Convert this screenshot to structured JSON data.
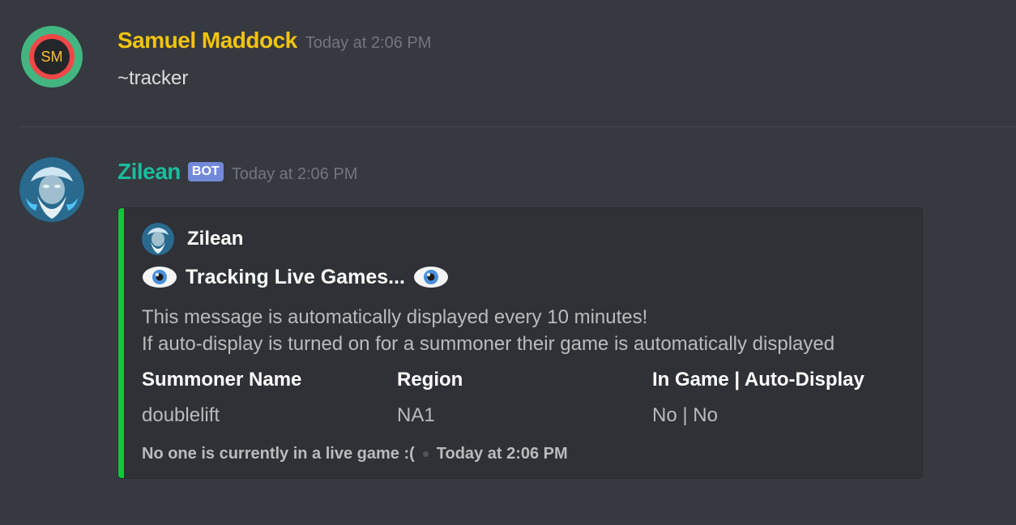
{
  "messages": [
    {
      "author": "Samuel Maddock",
      "avatar_initials": "SM",
      "timestamp": "Today at 2:06 PM",
      "content": "~tracker",
      "name_color": "#f1c40f"
    },
    {
      "author": "Zilean",
      "bot_tag": "BOT",
      "timestamp": "Today at 2:06 PM",
      "name_color": "#1abc9c",
      "embed": {
        "color": "#0ec73a",
        "author_name": "Zilean",
        "title_icon": "eye-icon",
        "title": "Tracking Live Games...",
        "description_line1": "This message is automatically displayed every 10 minutes!",
        "description_line2": "If auto-display is turned on for a summoner their game is automatically displayed",
        "fields": [
          {
            "name": "Summoner Name",
            "value": "doublelift"
          },
          {
            "name": "Region",
            "value": "NA1"
          },
          {
            "name": "In Game | Auto-Display",
            "value": "No | No"
          }
        ],
        "footer_text": "No one is currently in a live game :(",
        "footer_timestamp": "Today at 2:06 PM"
      }
    }
  ]
}
